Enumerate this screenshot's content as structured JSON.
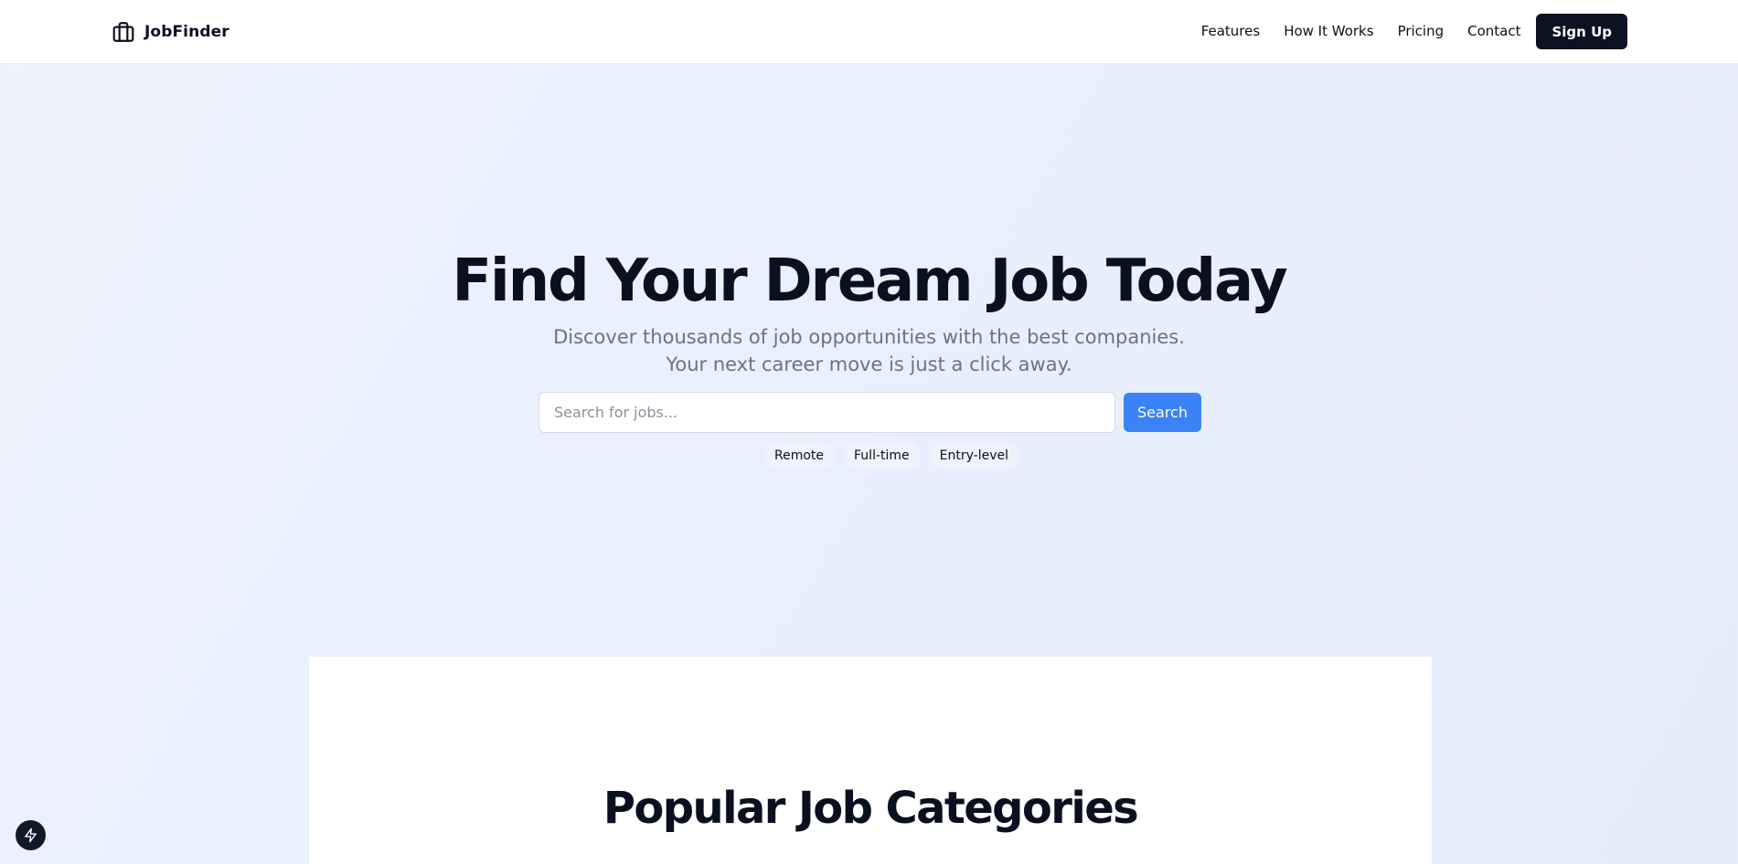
{
  "brand": {
    "name": "JobFinder",
    "icon": "briefcase-icon"
  },
  "nav": {
    "items": [
      "Features",
      "How It Works",
      "Pricing",
      "Contact"
    ],
    "signup_label": "Sign Up"
  },
  "hero": {
    "title": "Find Your Dream Job Today",
    "subtitle": "Discover thousands of job opportunities with the best companies. Your next career move is just a click away.",
    "search": {
      "placeholder": "Search for jobs...",
      "value": "",
      "button_label": "Search"
    },
    "tags": [
      "Remote",
      "Full-time",
      "Entry-level"
    ]
  },
  "categories": {
    "title": "Popular Job Categories"
  },
  "fab": {
    "icon": "lightning-icon"
  },
  "colors": {
    "accent": "#3b82f6",
    "dark": "#0c1222",
    "muted_text": "#6b7280"
  }
}
